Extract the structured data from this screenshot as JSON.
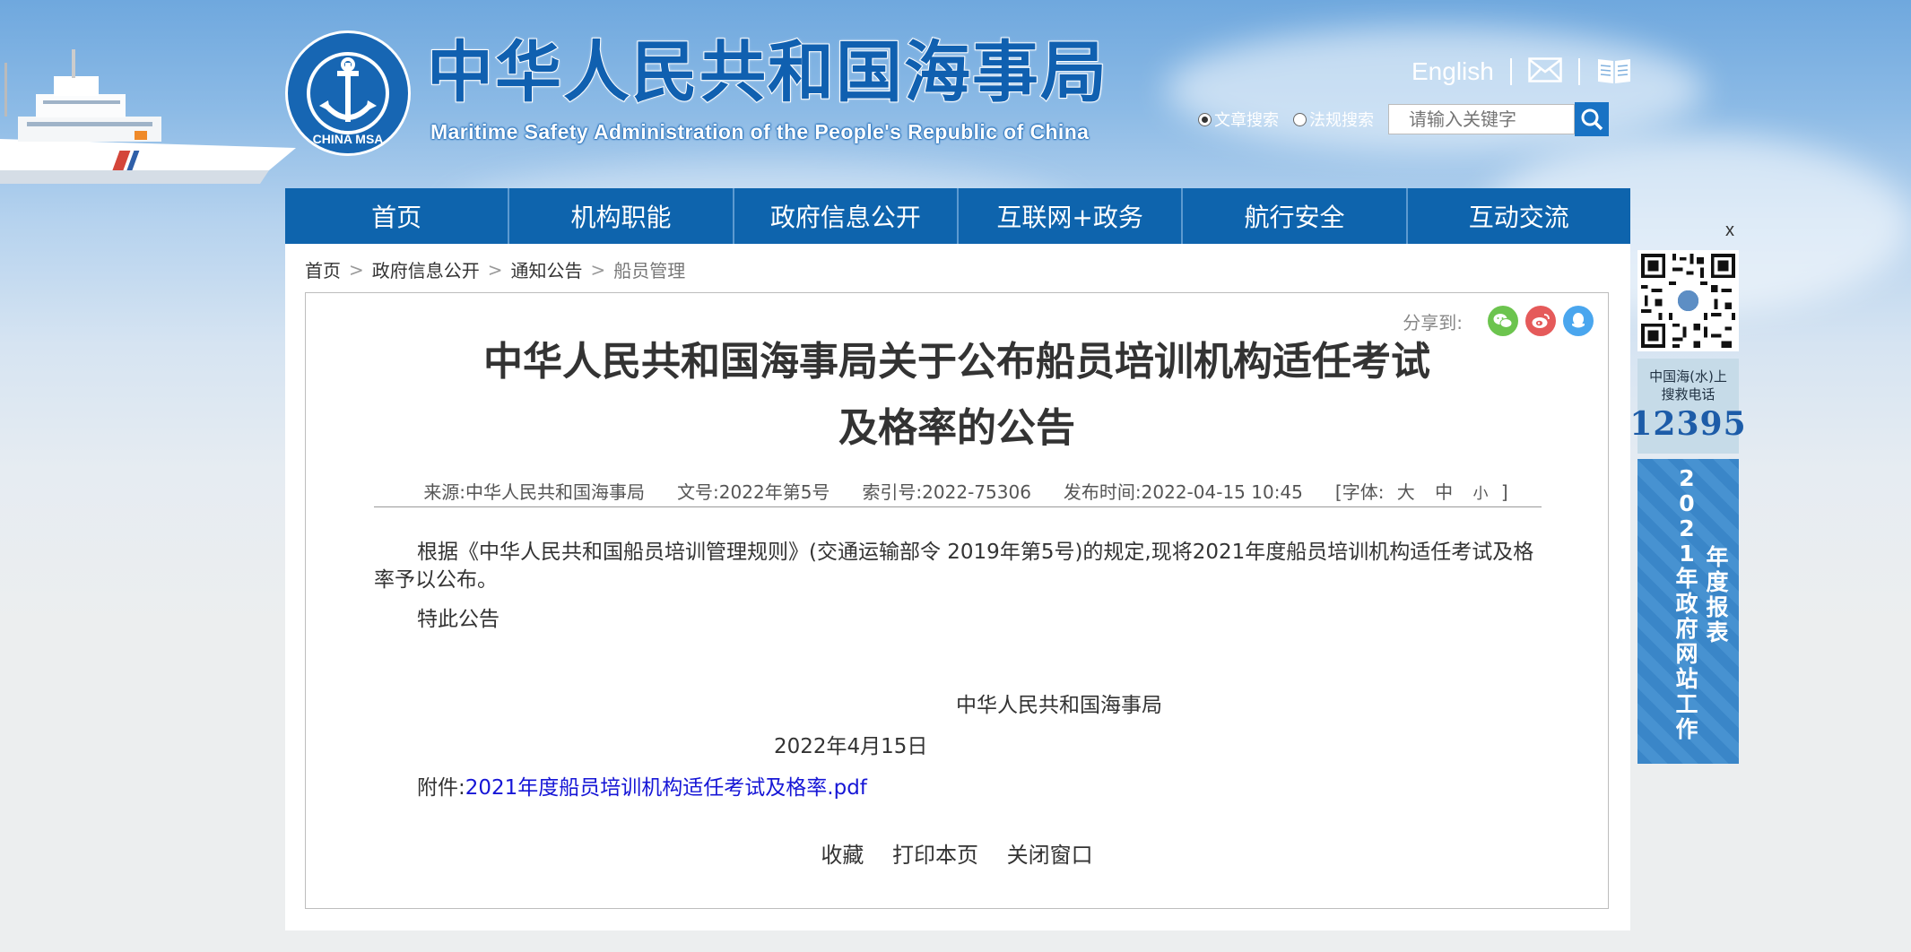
{
  "header": {
    "title_cn": "中华人民共和国海事局",
    "title_en": "Maritime Safety Administration of the People's Republic of China",
    "logo_text": "CHINA MSA",
    "english_link": "English",
    "search": {
      "options": [
        "文章搜索",
        "法规搜索"
      ],
      "selected": "文章搜索",
      "placeholder": "请输入关键字"
    }
  },
  "nav": [
    "首页",
    "机构职能",
    "政府信息公开",
    "互联网+政务",
    "航行安全",
    "互动交流"
  ],
  "breadcrumb": [
    "首页",
    "政府信息公开",
    "通知公告",
    "船员管理"
  ],
  "article": {
    "share_label": "分享到:",
    "title_line1": "中华人民共和国海事局关于公布船员培训机构适任考试",
    "title_line2": "及格率的公告",
    "meta": {
      "source": "来源:中华人民共和国海事局",
      "doc_no": "文号:2022年第5号",
      "index_no": "索引号:2022-75306",
      "publish_time": "发布时间:2022-04-15 10:45",
      "font_label": "[字体:",
      "font_sizes": [
        "大",
        "中",
        "小"
      ],
      "font_close": "]"
    },
    "paragraph1": "根据《中华人民共和国船员培训管理规则》(交通运输部令 2019年第5号)的规定,现将2021年度船员培训机构适任考试及格率予以公布。",
    "paragraph2": "特此公告",
    "sign_org": "中华人民共和国海事局",
    "sign_date": "2022年4月15日",
    "attachment_label": "附件:",
    "attachment_link": "2021年度船员培训机构适任考试及格率.pdf",
    "actions": [
      "收藏",
      "打印本页",
      "关闭窗口"
    ]
  },
  "sidebar": {
    "close": "x",
    "hotline_label_1": "中国海(水)上",
    "hotline_label_2": "搜救电话",
    "hotline_number": "12395",
    "report_col1": "2021年政府网站工作",
    "report_col2": "年度报表"
  }
}
